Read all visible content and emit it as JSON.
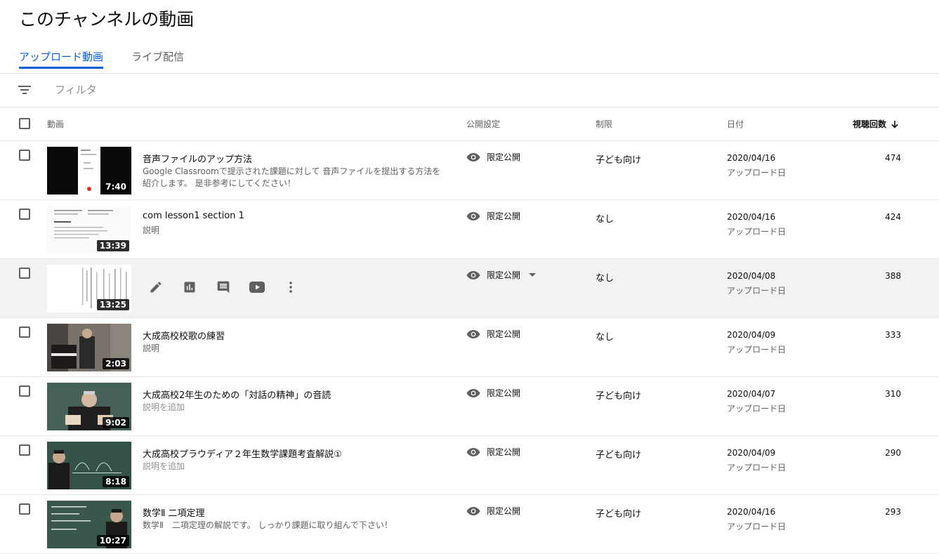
{
  "page": {
    "title": "このチャンネルの動画"
  },
  "tabs": [
    {
      "label": "アップロード動画",
      "active": true
    },
    {
      "label": "ライブ配信",
      "active": false
    }
  ],
  "filter": {
    "placeholder": "フィルタ",
    "icon": "filter-icon"
  },
  "table": {
    "headers": {
      "video": "動画",
      "visibility": "公開設定",
      "restrictions": "制限",
      "date": "日付",
      "views": "視聴回数"
    },
    "sort": {
      "column": "views",
      "direction": "desc",
      "icon": "arrow-down-icon"
    },
    "date_label": "アップロード日",
    "row_actions": [
      "edit-icon",
      "analytics-icon",
      "comments-icon",
      "youtube-icon",
      "more-options-icon"
    ],
    "rows": [
      {
        "title": "音声ファイルのアップ方法",
        "description": "Google Classroomで提示された課題に対して 音声ファイルを提出する方法を紹介します。 是非参考にしてください！",
        "duration": "7:40",
        "visibility": "限定公開",
        "restriction": "子ども向け",
        "date": "2020/04/16",
        "views": "474"
      },
      {
        "title": "com lesson1 section 1",
        "description": "説明",
        "duration": "13:39",
        "visibility": "限定公開",
        "restriction": "なし",
        "date": "2020/04/16",
        "views": "424"
      },
      {
        "title": "",
        "description": "",
        "duration": "13:25",
        "visibility": "限定公開",
        "restriction": "なし",
        "date": "2020/04/08",
        "views": "388"
      },
      {
        "title": "大成高校校歌の練習",
        "description": "説明",
        "duration": "2:03",
        "visibility": "限定公開",
        "restriction": "なし",
        "date": "2020/04/09",
        "views": "333"
      },
      {
        "title": "大成高校2年生のための「対話の精神」の音読",
        "description": "説明を追加",
        "duration": "9:02",
        "visibility": "限定公開",
        "restriction": "子ども向け",
        "date": "2020/04/07",
        "views": "310"
      },
      {
        "title": "大成高校プラウディア２年生数学課題考査解説①",
        "description": "説明を追加",
        "duration": "8:18",
        "visibility": "限定公開",
        "restriction": "子ども向け",
        "date": "2020/04/09",
        "views": "290"
      },
      {
        "title": "数学Ⅱ 二項定理",
        "description": "数学Ⅱ　二項定理の解説です。 しっかり課題に取り組んで下さい！",
        "duration": "10:27",
        "visibility": "限定公開",
        "restriction": "子ども向け",
        "date": "2020/04/16",
        "views": "293"
      }
    ]
  }
}
